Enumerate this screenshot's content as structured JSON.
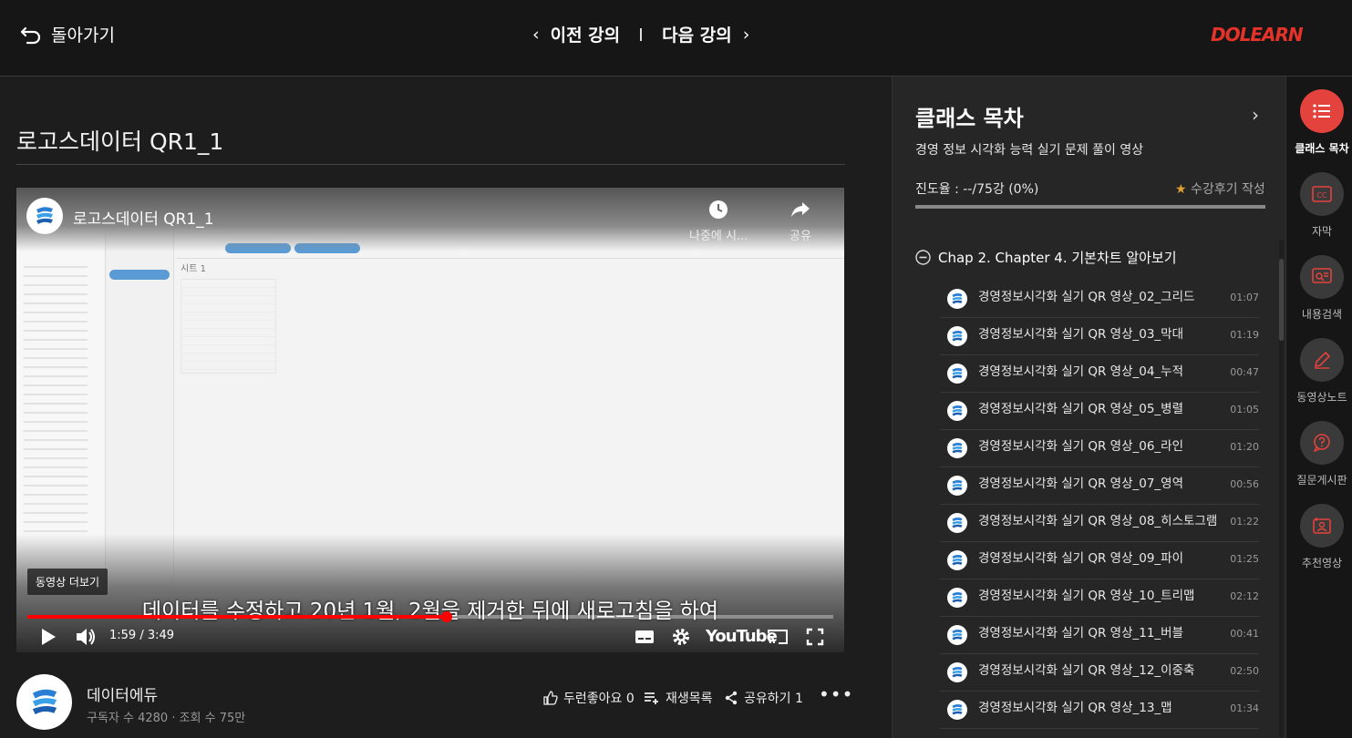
{
  "topbar": {
    "back_label": "돌아가기",
    "prev_label": "이전 강의",
    "next_label": "다음 강의",
    "logo_text": "DOLEARN",
    "logo_color": "#e5332a"
  },
  "main": {
    "title": "로고스데이터 QR1_1"
  },
  "video": {
    "title": "로고스데이터 QR1_1",
    "watch_later_label": "나중에 시...",
    "share_label": "공유",
    "more_videos_label": "동영상 더보기",
    "subtitle": "데이터를 수정하고 20년 1월, 2월을 제거한 뒤에 새로고침을 하여",
    "time": "1:59 / 3:49",
    "youtube_label": "YouTube",
    "progress": 0.52,
    "sheet_label": "시트 1",
    "progress_color": "#ff0000"
  },
  "channel": {
    "name": "데이터에듀",
    "stats": "구독자 수 4280 · 조회 수 75만",
    "like_label": "두런좋아요 0",
    "playlist_label": "재생목록",
    "share_label": "공유하기 1"
  },
  "panel": {
    "title": "클래스 목차",
    "subtitle": "경영 정보 시각화 능력 실기 문제 풀이 영상",
    "progress_text": "진도율 : --/75강 (0%)",
    "review_label": "수강후기 작성",
    "chapter": "Chap 2. Chapter 4. 기본차트 알아보기",
    "lessons": [
      {
        "title": "경영정보시각화 실기 QR 영상_02_그리드",
        "dur": "01:07"
      },
      {
        "title": "경영정보시각화 실기 QR 영상_03_막대",
        "dur": "01:19"
      },
      {
        "title": "경영정보시각화 실기 QR 영상_04_누적",
        "dur": "00:47"
      },
      {
        "title": "경영정보시각화 실기 QR 영상_05_병렬",
        "dur": "01:05"
      },
      {
        "title": "경영정보시각화 실기 QR 영상_06_라인",
        "dur": "01:20"
      },
      {
        "title": "경영정보시각화 실기 QR 영상_07_영역",
        "dur": "00:56"
      },
      {
        "title": "경영정보시각화 실기 QR 영상_08_히스토그램",
        "dur": "01:22"
      },
      {
        "title": "경영정보시각화 실기 QR 영상_09_파이",
        "dur": "01:25"
      },
      {
        "title": "경영정보시각화 실기 QR 영상_10_트리맵",
        "dur": "02:12"
      },
      {
        "title": "경영정보시각화 실기 QR 영상_11_버블",
        "dur": "00:41"
      },
      {
        "title": "경영정보시각화 실기 QR 영상_12_이중축",
        "dur": "02:50"
      },
      {
        "title": "경영정보시각화 실기 QR 영상_13_맵",
        "dur": "01:34"
      }
    ]
  },
  "rail": {
    "items": [
      {
        "label": "클래스 목차",
        "icon": "list-icon",
        "active": true
      },
      {
        "label": "자막",
        "icon": "cc-icon",
        "active": false
      },
      {
        "label": "내용검색",
        "icon": "content-search-icon",
        "active": false
      },
      {
        "label": "동영상노트",
        "icon": "pencil-icon",
        "active": false
      },
      {
        "label": "질문게시판",
        "icon": "question-icon",
        "active": false
      },
      {
        "label": "추천영상",
        "icon": "recommend-icon",
        "active": false
      }
    ],
    "active_color": "#e4423d"
  }
}
